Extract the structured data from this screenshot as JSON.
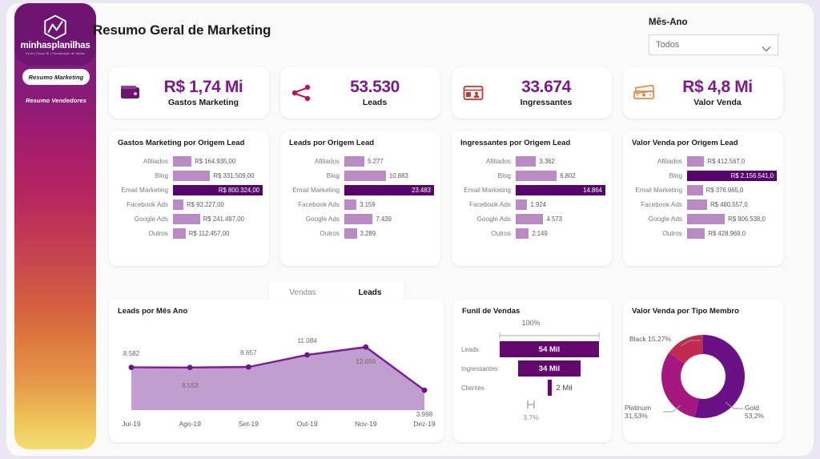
{
  "header": {
    "title": "Resumo Geral de Marketing",
    "slicer_label": "Mês-Ano",
    "slicer_value": "Todos"
  },
  "sidebar": {
    "logo_name": "minhasplanilhas",
    "logo_tagline": "Excel | Power BI | Visualização de Dados",
    "items": [
      {
        "label": "Resumo Marketing",
        "active": true
      },
      {
        "label": "Resumo Vendedores",
        "active": false
      }
    ]
  },
  "kpis": [
    {
      "value": "R$ 1,74 Mi",
      "label": "Gastos Marketing",
      "icon": "wallet-icon"
    },
    {
      "value": "53.530",
      "label": "Leads",
      "icon": "funnel-share-icon"
    },
    {
      "value": "33.674",
      "label": "Ingressantes",
      "icon": "id-card-icon"
    },
    {
      "value": "R$ 4,8 Mi",
      "label": "Valor Venda",
      "icon": "money-icon"
    }
  ],
  "chart_data": [
    {
      "type": "bar",
      "title": "Gastos Marketing por Origem Lead",
      "orientation": "horizontal",
      "categories": [
        "Afiliados",
        "Blog",
        "Email Marketing",
        "Facebook Ads",
        "Google Ads",
        "Outros"
      ],
      "values": [
        164935,
        331509,
        800324,
        93227,
        241497,
        112457
      ],
      "labels": [
        "R$ 164.935,00",
        "R$ 331.509,00",
        "R$ 800.324,00",
        "R$ 93.227,00",
        "R$ 241.497,00",
        "R$ 112.457,00"
      ],
      "highlight_index": 2,
      "xlabel": "",
      "ylabel": "",
      "grid": false,
      "legend": false
    },
    {
      "type": "bar",
      "title": "Leads por Origem Lead",
      "orientation": "horizontal",
      "categories": [
        "Afiliados",
        "Blog",
        "Email Marketing",
        "Facebook Ads",
        "Google Ads",
        "Outros"
      ],
      "values": [
        5277,
        10883,
        23483,
        3159,
        7439,
        3289
      ],
      "labels": [
        "5.277",
        "10.883",
        "23.483",
        "3.159",
        "7.439",
        "3.289"
      ],
      "highlight_index": 2,
      "xlabel": "",
      "ylabel": "",
      "grid": false,
      "legend": false
    },
    {
      "type": "bar",
      "title": "Ingressantes por Origem Lead",
      "orientation": "horizontal",
      "categories": [
        "Afiliados",
        "Blog",
        "Email Marketing",
        "Facebook Ads",
        "Google Ads",
        "Outros"
      ],
      "values": [
        3362,
        6802,
        14864,
        1924,
        4573,
        2149
      ],
      "labels": [
        "3.362",
        "6.802",
        "14.864",
        "1.924",
        "4.573",
        "2.149"
      ],
      "highlight_index": 2,
      "xlabel": "",
      "ylabel": "",
      "grid": false,
      "legend": false
    },
    {
      "type": "bar",
      "title": "Valor Venda por Origem Lead",
      "orientation": "horizontal",
      "categories": [
        "Afiliados",
        "Blog",
        "Email Marketing",
        "Facebook Ads",
        "Google Ads",
        "Outros"
      ],
      "values": [
        412567,
        2156541,
        376965,
        480557,
        906538,
        428969
      ],
      "labels": [
        "R$ 412.567,0",
        "R$ 2.156.541,0",
        "R$ 376.965,0",
        "R$ 480.557,0",
        "R$ 906.538,0",
        "R$ 428.969,0"
      ],
      "highlight_index": 1,
      "xlabel": "",
      "ylabel": "",
      "grid": false,
      "legend": false
    },
    {
      "type": "area",
      "title": "Leads por Mês Ano",
      "categories": [
        "Jul-19",
        "Ago-19",
        "Set-19",
        "Out-19",
        "Nov-19",
        "Dez-19"
      ],
      "values": [
        8582,
        8553,
        8657,
        11084,
        12656,
        3998
      ],
      "labels": [
        "8.582",
        "8.553",
        "8.657",
        "11.084",
        "12.656",
        "3.998"
      ],
      "xlabel": "",
      "ylabel": "",
      "ylim": [
        0,
        13500
      ],
      "grid": false,
      "legend": false
    },
    {
      "type": "bar",
      "title": "Funil de Vendas",
      "orientation": "funnel",
      "top_label": "100%",
      "bottom_label": "3,7%",
      "categories": [
        "Leads",
        "Ingressantes",
        "Clientes"
      ],
      "values": [
        54,
        34,
        2
      ],
      "labels": [
        "54 Mil",
        "34 Mil",
        "2 Mil"
      ],
      "xlabel": "",
      "ylabel": "",
      "grid": false,
      "legend": false
    },
    {
      "type": "pie",
      "title": "Valor Venda por Tipo Membro",
      "categories": [
        "Gold",
        "Platinum",
        "Black"
      ],
      "values": [
        53.2,
        31.53,
        15.27
      ],
      "labels": [
        "Gold 53,2%",
        "Platinum 31,53%",
        "Black 15,27%"
      ],
      "label_texts": {
        "gold_name": "Gold",
        "gold_pct": "53,2%",
        "platinum_name": "Platinum",
        "platinum_pct": "31,53%",
        "black": "Black 15,27%"
      },
      "colors": [
        "#6b1187",
        "#a5187f",
        "#c32a52"
      ],
      "legend": false,
      "grid": false
    }
  ],
  "tabs": [
    {
      "label": "Vendas",
      "active": false
    },
    {
      "label": "Leads",
      "active": true
    }
  ],
  "colors": {
    "accent": "#7a1c86",
    "bar": "#b98ac4",
    "bar_highlight": "#55046b",
    "canvas": "#fafafa",
    "page_bg": "#ebe7f2"
  }
}
